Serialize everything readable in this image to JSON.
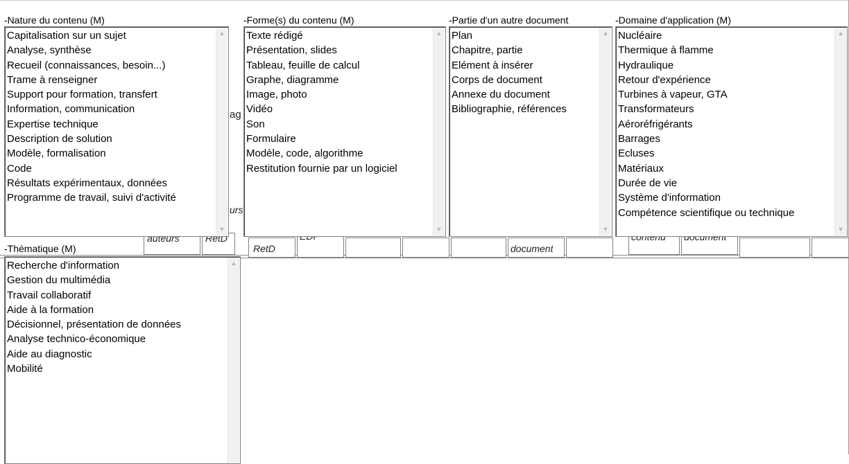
{
  "panels": {
    "nature": {
      "label": "Nature du contenu (M)",
      "items": [
        "Capitalisation sur un sujet",
        "Analyse, synthèse",
        "Recueil (connaissances, besoin...)",
        "Trame à renseigner",
        "Support pour formation, transfert",
        "Information, communication",
        "Expertise technique",
        "Description de solution",
        "Modèle, formalisation",
        "Code",
        "Résultats expérimentaux, données",
        "Programme de travail, suivi d'activité"
      ]
    },
    "forme": {
      "label": "Forme(s) du contenu (M)",
      "items": [
        "Texte rédigé",
        "Présentation, slides",
        "Tableau, feuille de calcul",
        "Graphe, diagramme",
        "Image, photo",
        "Vidéo",
        "Son",
        "Formulaire",
        "Modèle, code, algorithme",
        "Restitution fournie par un logiciel"
      ]
    },
    "partie": {
      "label": "Partie d'un autre document",
      "items": [
        "Plan",
        "Chapitre, partie",
        "Elément à insérer",
        "Corps de document",
        "Annexe du document",
        "Bibliographie, références"
      ]
    },
    "domaine": {
      "label": "Domaine d'application (M)",
      "items": [
        "Nucléaire",
        "Thermique à flamme",
        "Hydraulique",
        "Retour d'expérience",
        "Turbines à vapeur, GTA",
        "Transformateurs",
        "Aéroréfrigérants",
        "Barrages",
        "Ecluses",
        "Matériaux",
        "Durée de vie",
        "Système d'information",
        "Compétence scientifique ou technique"
      ]
    },
    "thematique": {
      "label": "Thématique (M)",
      "items": [
        "Recherche d'information",
        "Gestion du multimédia",
        "Travail collaboratif",
        "Aide à la formation",
        "Décisionnel, présentation de données",
        "Analyse technico-économique",
        "Aide au diagnostic",
        "Mobilité"
      ]
    }
  },
  "background_fragments": {
    "auteurs": "auteurs",
    "retd_a": "RetD",
    "retd_b": "RetD",
    "edf": "EDF",
    "document_a": "document",
    "contenu": "contenu",
    "document_b": "document",
    "ag": "ag",
    "urs": "urs"
  },
  "icons": {
    "scroll_up": "scroll-up-arrow",
    "scroll_down": "scroll-down-arrow"
  }
}
